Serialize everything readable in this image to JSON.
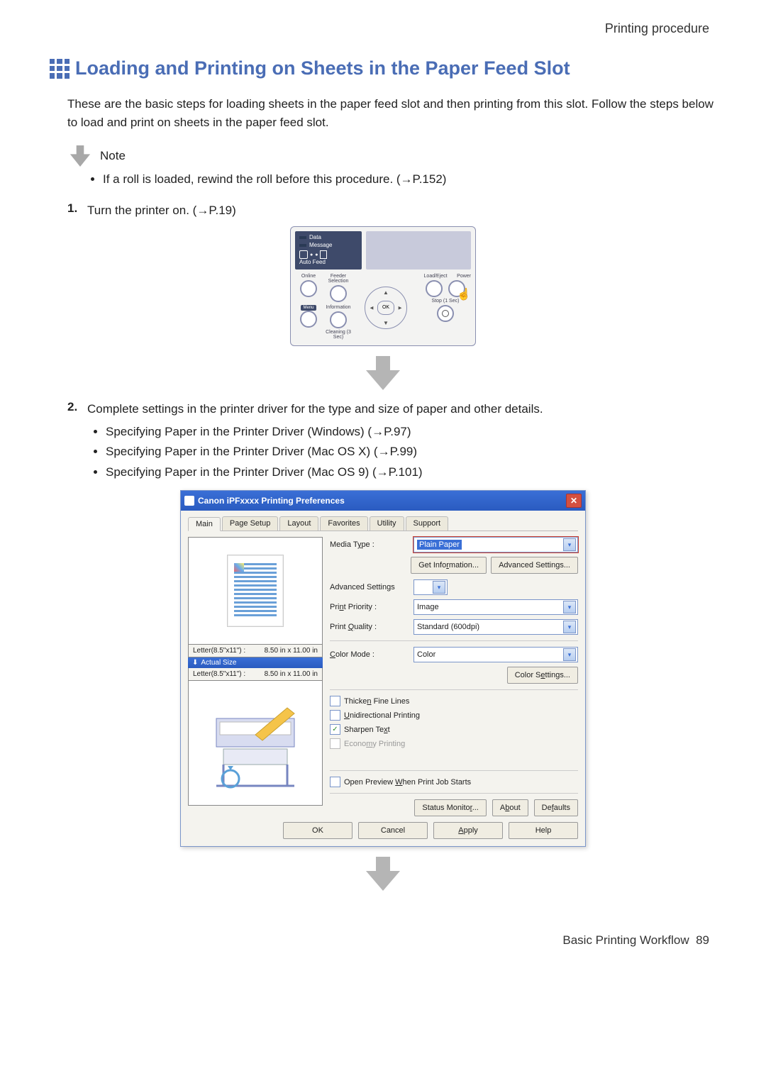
{
  "header": {
    "section": "Printing procedure"
  },
  "title": "Loading and Printing on Sheets in the Paper Feed Slot",
  "intro": "These are the basic steps for loading sheets in the paper feed slot and then printing from this slot. Follow the steps below to load and print on sheets in the paper feed slot.",
  "note": {
    "label": "Note",
    "items": [
      "If a roll is loaded, rewind the roll before this procedure. (→P.152)"
    ]
  },
  "steps": [
    {
      "num": "1.",
      "text": "Turn the printer on.  (→P.19)"
    },
    {
      "num": "2.",
      "text": "Complete settings in the printer driver for the type and size of paper and other details.",
      "sub": [
        "Specifying Paper in the Printer Driver (Windows) (→P.97)",
        "Specifying Paper in the Printer Driver (Mac OS X) (→P.99)",
        "Specifying Paper in the Printer Driver (Mac OS 9) (→P.101)"
      ]
    }
  ],
  "control_panel": {
    "top_labels": {
      "data": "Data",
      "message": "Message",
      "auto": "Auto Feed"
    },
    "left": {
      "online": "Online",
      "feeder": "Feeder Selection",
      "menu": "Menu",
      "info": "Information",
      "cleaning": "Cleaning (3 Sec)"
    },
    "center": {
      "ok": "OK"
    },
    "right": {
      "load": "Load/Eject",
      "power": "Power",
      "stop": "Stop (1 Sec)"
    }
  },
  "dialog": {
    "title": "Canon iPFxxxx Printing Preferences",
    "tabs": [
      "Main",
      "Page Setup",
      "Layout",
      "Favorites",
      "Utility",
      "Support"
    ],
    "left": {
      "size1_name": "Letter(8.5\"x11\") :",
      "size1_dim": "8.50 in x 11.00 in",
      "actual": "Actual Size",
      "size2_name": "Letter(8.5\"x11\") :",
      "size2_dim": "8.50 in x 11.00 in"
    },
    "form": {
      "media_type_label": "Media Type :",
      "media_type_value": "Plain Paper",
      "get_info": "Get Information...",
      "adv_settings_btn": "Advanced Settings...",
      "adv_settings_label": "Advanced Settings",
      "print_priority_label": "Print Priority :",
      "print_priority_value": "Image",
      "print_quality_label": "Print Quality :",
      "print_quality_value": "Standard (600dpi)",
      "color_mode_label": "Color Mode :",
      "color_mode_value": "Color",
      "color_settings": "Color Settings...",
      "chk_thicken": "Thicken Fine Lines",
      "chk_uni": "Unidirectional Printing",
      "chk_sharpen": "Sharpen Text",
      "chk_economy": "Economy Printing",
      "chk_preview": "Open Preview When Print Job Starts",
      "status_monitor": "Status Monitor...",
      "about": "About",
      "defaults": "Defaults"
    },
    "buttons": {
      "ok": "OK",
      "cancel": "Cancel",
      "apply": "Apply",
      "help": "Help"
    }
  },
  "footer": {
    "text": "Basic Printing Workflow",
    "page": "89"
  }
}
